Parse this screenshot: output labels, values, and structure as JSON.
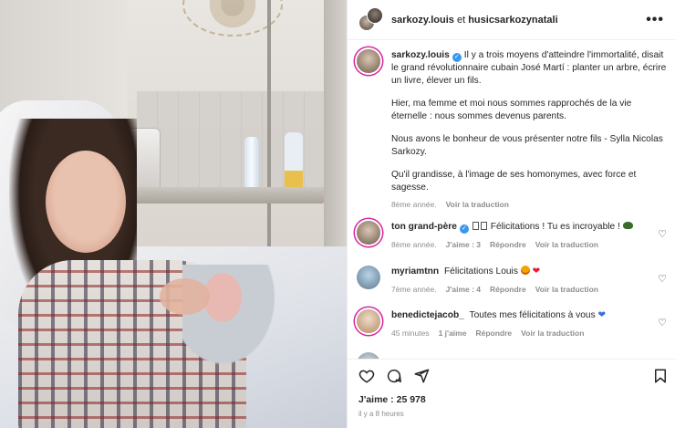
{
  "header": {
    "user1": "sarkozy.louis",
    "joiner": "et",
    "user2": "husicsarkozynatali",
    "more_label": "•••"
  },
  "caption": {
    "username": "sarkozy.louis",
    "p1": "Il y a trois moyens d'atteindre l'immortalité, disait le grand révolutionnaire cubain José Martí : planter un arbre, écrire un livre, élever un fils.",
    "p2": "Hier, ma femme et moi nous sommes rapprochés de la vie éternelle : nous sommes devenus parents.",
    "p3": "Nous avons le bonheur de vous présenter notre fils - Sylla Nicolas Sarkozy.",
    "p4": "Qu'il grandisse, à l'image de ses homonymes, avec force et sagesse.",
    "age": "8ème année.",
    "translate": "Voir la traduction"
  },
  "comments": [
    {
      "username": "ton grand-père",
      "text": "Félicitations ! Tu es incroyable !",
      "age": "8ème année.",
      "likes": "J'aime : 3",
      "reply": "Répondre",
      "translate": "Voir la traduction"
    },
    {
      "username": "myriamtnn",
      "text": "Félicitations Louis",
      "age": "7ème année.",
      "likes": "J'aime : 4",
      "reply": "Répondre",
      "translate": "Voir la traduction"
    },
    {
      "username": "benedictejacob_",
      "text": "Toutes mes félicitations à vous",
      "age": "45 minutes",
      "likes": "1 j'aime",
      "reply": "Répondre",
      "translate": "Voir la traduction"
    }
  ],
  "footer": {
    "likes": "J'aime : 25 978",
    "time": "il y a 8 heures"
  },
  "colors": {
    "story_ring": "#d6249f",
    "verified": "#3897f0",
    "muted_text": "#8e8e8e"
  }
}
